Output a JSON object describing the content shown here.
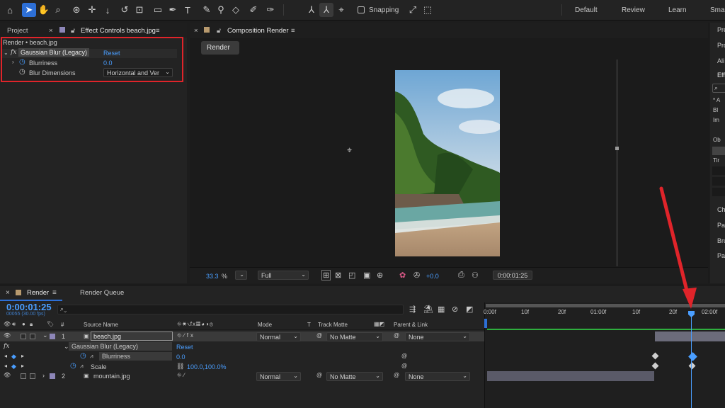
{
  "workspaces": [
    "Default",
    "Review",
    "Learn",
    "Smal"
  ],
  "toolbar": {
    "snapping_label": "Snapping"
  },
  "effect_controls": {
    "project_tab": "Project",
    "tab_label": "Effect Controls beach.jpg",
    "breadcrumb": "Render • beach.jpg",
    "fx_label": "fx",
    "effect_name": "Gaussian Blur (Legacy)",
    "reset_label": "Reset",
    "blurriness_label": "Blurriness",
    "blurriness_value": "0.0",
    "blur_dimensions_label": "Blur Dimensions",
    "blur_dimensions_value": "Horizontal and Ver"
  },
  "composition": {
    "tab_label": "Composition Render",
    "render_button": "Render",
    "zoom_value": "33.3",
    "zoom_unit": "%",
    "resolution": "Full",
    "exposure": "+0.0",
    "timecode": "0:00:01:25"
  },
  "right_panel": {
    "items": [
      "Pre",
      "Pro",
      "Ali",
      "Effe",
      "* A",
      "Bl",
      "Im",
      "Ob",
      "Tir",
      "Cha",
      "Par",
      "Bru",
      "Pai"
    ]
  },
  "timeline": {
    "tab_label": "Render",
    "render_queue_label": "Render Queue",
    "current_time": "0:00:01:25",
    "frame_info": "00055 (30.00 fps)",
    "columns": {
      "number": "#",
      "source_name": "Source Name",
      "mode": "Mode",
      "t": "T",
      "track_matte": "Track Matte",
      "parent_link": "Parent & Link"
    },
    "ruler_labels": [
      "0:00f",
      "10f",
      "20f",
      "01:00f",
      "10f",
      "20f",
      "02:00f"
    ],
    "layers": [
      {
        "number": "1",
        "name": "beach.jpg",
        "mode": "Normal",
        "matte": "No Matte",
        "parent": "None"
      },
      {
        "number": "2",
        "name": "mountain.jpg",
        "mode": "Normal",
        "matte": "No Matte",
        "parent": "None"
      }
    ],
    "effect_row": {
      "fx": "fx",
      "name": "Gaussian Blur (Legacy)",
      "reset": "Reset"
    },
    "blurriness_row": {
      "label": "Blurriness",
      "value": "0.0"
    },
    "scale_row": {
      "label": "Scale",
      "value": "100.0,100.0%"
    }
  },
  "colors": {
    "accent": "#2d6fd6",
    "annotation_red": "#e0242a",
    "timecode_blue": "#4a9eff"
  }
}
